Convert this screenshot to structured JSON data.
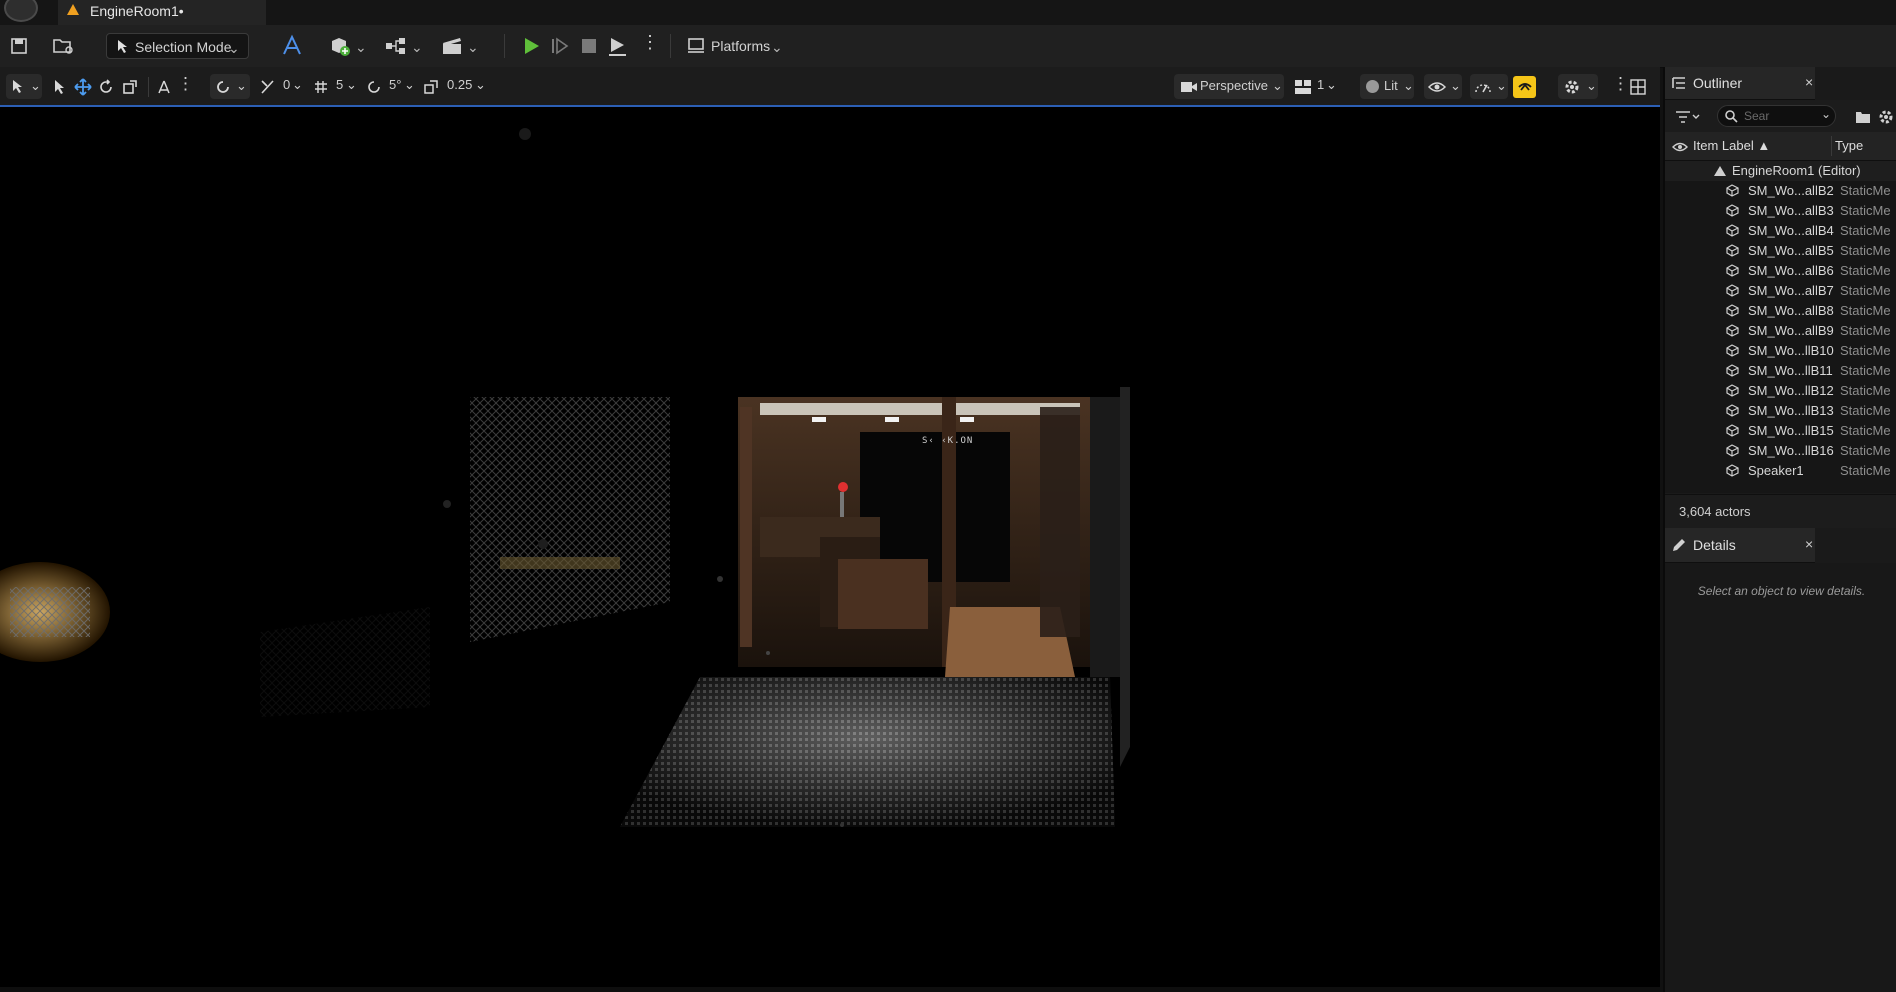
{
  "window": {
    "level_tab": "EngineRoom1•"
  },
  "toolbar": {
    "selection_mode": "Selection Mode",
    "platforms": "Platforms"
  },
  "viewport_toolbar": {
    "rotation_snap": "0",
    "grid_snap": "5",
    "angle_snap": "5°",
    "scale_snap": "0.25",
    "view_mode": "Perspective",
    "camera_speed": "1",
    "lighting_mode": "Lit"
  },
  "viewport_scene": {
    "sign_text": "S‹ ‹K.ON"
  },
  "outliner": {
    "title": "Outliner",
    "search_placeholder": "Sear",
    "col_label": "Item Label ▲",
    "col_type": "Type",
    "root": "EngineRoom1 (Editor)",
    "items": [
      {
        "label": "SM_Wo...allB2",
        "type": "StaticMe"
      },
      {
        "label": "SM_Wo...allB3",
        "type": "StaticMe"
      },
      {
        "label": "SM_Wo...allB4",
        "type": "StaticMe"
      },
      {
        "label": "SM_Wo...allB5",
        "type": "StaticMe"
      },
      {
        "label": "SM_Wo...allB6",
        "type": "StaticMe"
      },
      {
        "label": "SM_Wo...allB7",
        "type": "StaticMe"
      },
      {
        "label": "SM_Wo...allB8",
        "type": "StaticMe"
      },
      {
        "label": "SM_Wo...allB9",
        "type": "StaticMe"
      },
      {
        "label": "SM_Wo...llB10",
        "type": "StaticMe"
      },
      {
        "label": "SM_Wo...llB11",
        "type": "StaticMe"
      },
      {
        "label": "SM_Wo...llB12",
        "type": "StaticMe"
      },
      {
        "label": "SM_Wo...llB13",
        "type": "StaticMe"
      },
      {
        "label": "SM_Wo...llB15",
        "type": "StaticMe"
      },
      {
        "label": "SM_Wo...llB16",
        "type": "StaticMe"
      },
      {
        "label": "Speaker1",
        "type": "StaticMe"
      }
    ],
    "count": "3,604 actors"
  },
  "details": {
    "title": "Details",
    "empty_hint": "Select an object to view details."
  },
  "colors": {
    "accent": "#2c5fb5",
    "play": "#5fbf3a",
    "highlight": "#f5c518"
  }
}
